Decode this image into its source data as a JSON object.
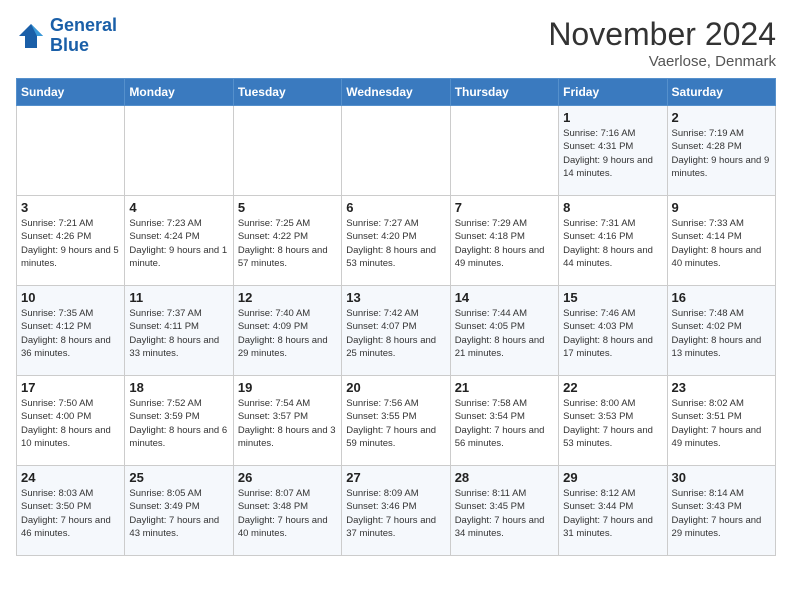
{
  "header": {
    "logo_line1": "General",
    "logo_line2": "Blue",
    "month": "November 2024",
    "location": "Vaerlose, Denmark"
  },
  "weekdays": [
    "Sunday",
    "Monday",
    "Tuesday",
    "Wednesday",
    "Thursday",
    "Friday",
    "Saturday"
  ],
  "weeks": [
    [
      {
        "day": "",
        "info": ""
      },
      {
        "day": "",
        "info": ""
      },
      {
        "day": "",
        "info": ""
      },
      {
        "day": "",
        "info": ""
      },
      {
        "day": "",
        "info": ""
      },
      {
        "day": "1",
        "info": "Sunrise: 7:16 AM\nSunset: 4:31 PM\nDaylight: 9 hours\nand 14 minutes."
      },
      {
        "day": "2",
        "info": "Sunrise: 7:19 AM\nSunset: 4:28 PM\nDaylight: 9 hours\nand 9 minutes."
      }
    ],
    [
      {
        "day": "3",
        "info": "Sunrise: 7:21 AM\nSunset: 4:26 PM\nDaylight: 9 hours\nand 5 minutes."
      },
      {
        "day": "4",
        "info": "Sunrise: 7:23 AM\nSunset: 4:24 PM\nDaylight: 9 hours\nand 1 minute."
      },
      {
        "day": "5",
        "info": "Sunrise: 7:25 AM\nSunset: 4:22 PM\nDaylight: 8 hours\nand 57 minutes."
      },
      {
        "day": "6",
        "info": "Sunrise: 7:27 AM\nSunset: 4:20 PM\nDaylight: 8 hours\nand 53 minutes."
      },
      {
        "day": "7",
        "info": "Sunrise: 7:29 AM\nSunset: 4:18 PM\nDaylight: 8 hours\nand 49 minutes."
      },
      {
        "day": "8",
        "info": "Sunrise: 7:31 AM\nSunset: 4:16 PM\nDaylight: 8 hours\nand 44 minutes."
      },
      {
        "day": "9",
        "info": "Sunrise: 7:33 AM\nSunset: 4:14 PM\nDaylight: 8 hours\nand 40 minutes."
      }
    ],
    [
      {
        "day": "10",
        "info": "Sunrise: 7:35 AM\nSunset: 4:12 PM\nDaylight: 8 hours\nand 36 minutes."
      },
      {
        "day": "11",
        "info": "Sunrise: 7:37 AM\nSunset: 4:11 PM\nDaylight: 8 hours\nand 33 minutes."
      },
      {
        "day": "12",
        "info": "Sunrise: 7:40 AM\nSunset: 4:09 PM\nDaylight: 8 hours\nand 29 minutes."
      },
      {
        "day": "13",
        "info": "Sunrise: 7:42 AM\nSunset: 4:07 PM\nDaylight: 8 hours\nand 25 minutes."
      },
      {
        "day": "14",
        "info": "Sunrise: 7:44 AM\nSunset: 4:05 PM\nDaylight: 8 hours\nand 21 minutes."
      },
      {
        "day": "15",
        "info": "Sunrise: 7:46 AM\nSunset: 4:03 PM\nDaylight: 8 hours\nand 17 minutes."
      },
      {
        "day": "16",
        "info": "Sunrise: 7:48 AM\nSunset: 4:02 PM\nDaylight: 8 hours\nand 13 minutes."
      }
    ],
    [
      {
        "day": "17",
        "info": "Sunrise: 7:50 AM\nSunset: 4:00 PM\nDaylight: 8 hours\nand 10 minutes."
      },
      {
        "day": "18",
        "info": "Sunrise: 7:52 AM\nSunset: 3:59 PM\nDaylight: 8 hours\nand 6 minutes."
      },
      {
        "day": "19",
        "info": "Sunrise: 7:54 AM\nSunset: 3:57 PM\nDaylight: 8 hours\nand 3 minutes."
      },
      {
        "day": "20",
        "info": "Sunrise: 7:56 AM\nSunset: 3:55 PM\nDaylight: 7 hours\nand 59 minutes."
      },
      {
        "day": "21",
        "info": "Sunrise: 7:58 AM\nSunset: 3:54 PM\nDaylight: 7 hours\nand 56 minutes."
      },
      {
        "day": "22",
        "info": "Sunrise: 8:00 AM\nSunset: 3:53 PM\nDaylight: 7 hours\nand 53 minutes."
      },
      {
        "day": "23",
        "info": "Sunrise: 8:02 AM\nSunset: 3:51 PM\nDaylight: 7 hours\nand 49 minutes."
      }
    ],
    [
      {
        "day": "24",
        "info": "Sunrise: 8:03 AM\nSunset: 3:50 PM\nDaylight: 7 hours\nand 46 minutes."
      },
      {
        "day": "25",
        "info": "Sunrise: 8:05 AM\nSunset: 3:49 PM\nDaylight: 7 hours\nand 43 minutes."
      },
      {
        "day": "26",
        "info": "Sunrise: 8:07 AM\nSunset: 3:48 PM\nDaylight: 7 hours\nand 40 minutes."
      },
      {
        "day": "27",
        "info": "Sunrise: 8:09 AM\nSunset: 3:46 PM\nDaylight: 7 hours\nand 37 minutes."
      },
      {
        "day": "28",
        "info": "Sunrise: 8:11 AM\nSunset: 3:45 PM\nDaylight: 7 hours\nand 34 minutes."
      },
      {
        "day": "29",
        "info": "Sunrise: 8:12 AM\nSunset: 3:44 PM\nDaylight: 7 hours\nand 31 minutes."
      },
      {
        "day": "30",
        "info": "Sunrise: 8:14 AM\nSunset: 3:43 PM\nDaylight: 7 hours\nand 29 minutes."
      }
    ]
  ]
}
